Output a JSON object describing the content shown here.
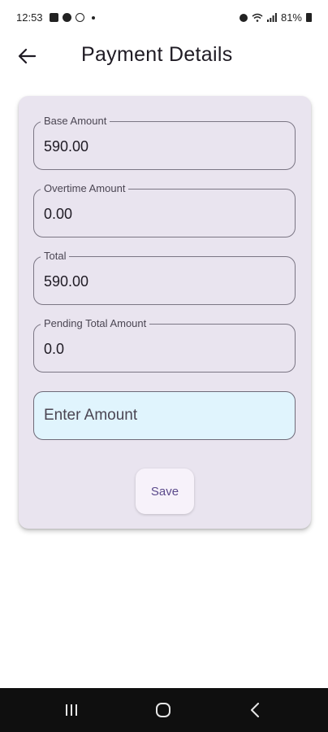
{
  "status_bar": {
    "time": "12:53",
    "battery": "81%",
    "left_icons": [
      "gallery-icon",
      "chat-icon",
      "whatsapp-icon"
    ],
    "right_icons": [
      "alarm-icon",
      "wifi-icon",
      "signal-icon",
      "battery-icon"
    ]
  },
  "app_bar": {
    "title": "Payment Details",
    "back_icon": "arrow-left-icon"
  },
  "form": {
    "base_amount": {
      "label": "Base Amount",
      "value": "590.00"
    },
    "overtime_amount": {
      "label": "Overtime Amount",
      "value": "0.00"
    },
    "total": {
      "label": "Total",
      "value": "590.00"
    },
    "pending_total_amount": {
      "label": "Pending Total Amount",
      "value": "0.0"
    },
    "amount_input": {
      "placeholder": "Enter Amount",
      "value": ""
    },
    "save_label": "Save"
  },
  "colors": {
    "card_background": "#e9e4ef",
    "input_background": "#e0f4fd",
    "save_text": "#5b4a8b",
    "nav_bar": "#0f0f0f"
  },
  "nav_bar": {
    "recent_icon": "recent-apps-icon",
    "home_icon": "home-icon",
    "back_icon": "back-icon"
  }
}
